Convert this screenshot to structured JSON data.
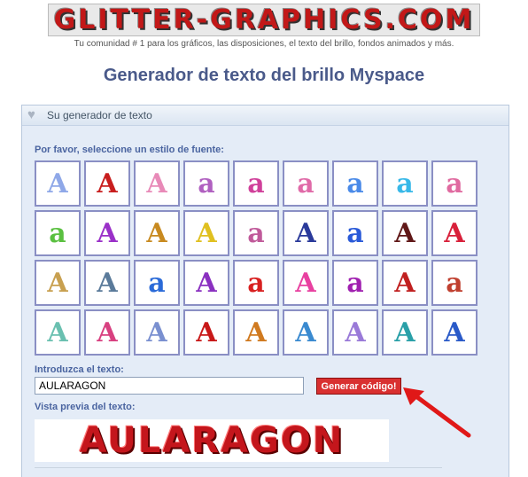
{
  "header": {
    "logo": "GLITTER-GRAPHICS.COM",
    "tagline": "Tu comunidad # 1 para los gráficos, las disposiciones, el texto del brillo, fondos animados y más."
  },
  "page_title": "Generador de texto del brillo Myspace",
  "panel": {
    "title": "Su generador de texto",
    "font_style_label": "Por favor, seleccione un estilo de fuente:",
    "input_label": "Introduzca el texto:",
    "input_value": "AULARAGON",
    "generate_button": "Generar código!",
    "preview_label": "Vista previa del texto:",
    "preview_text": "AULARAGON"
  },
  "font_styles": [
    {
      "glyph": "A",
      "color": "#8fa8e8"
    },
    {
      "glyph": "A",
      "color": "#c81e1e"
    },
    {
      "glyph": "A",
      "color": "#e88ab8"
    },
    {
      "glyph": "a",
      "color": "#b060c0"
    },
    {
      "glyph": "a",
      "color": "#d0409a"
    },
    {
      "glyph": "a",
      "color": "#e06aa8"
    },
    {
      "glyph": "a",
      "color": "#4a8ae8"
    },
    {
      "glyph": "a",
      "color": "#38b8e8"
    },
    {
      "glyph": "a",
      "color": "#e06aa0"
    },
    {
      "glyph": "a",
      "color": "#5ac040"
    },
    {
      "glyph": "A",
      "color": "#9a30c8"
    },
    {
      "glyph": "A",
      "color": "#c88a20"
    },
    {
      "glyph": "A",
      "color": "#e0c020"
    },
    {
      "glyph": "a",
      "color": "#c05a9a"
    },
    {
      "glyph": "A",
      "color": "#2a3a9a"
    },
    {
      "glyph": "a",
      "color": "#2a5ad8"
    },
    {
      "glyph": "A",
      "color": "#601818"
    },
    {
      "glyph": "A",
      "color": "#d8203a"
    },
    {
      "glyph": "A",
      "color": "#c8a050"
    },
    {
      "glyph": "A",
      "color": "#5a7a9a"
    },
    {
      "glyph": "a",
      "color": "#2a6ad8"
    },
    {
      "glyph": "A",
      "color": "#8a30c0"
    },
    {
      "glyph": "a",
      "color": "#d82020"
    },
    {
      "glyph": "A",
      "color": "#e840a0"
    },
    {
      "glyph": "a",
      "color": "#a020b0"
    },
    {
      "glyph": "A",
      "color": "#c02020"
    },
    {
      "glyph": "a",
      "color": "#c04030"
    },
    {
      "glyph": "A",
      "color": "#6ac0b0"
    },
    {
      "glyph": "A",
      "color": "#d84080"
    },
    {
      "glyph": "A",
      "color": "#7a90d0"
    },
    {
      "glyph": "A",
      "color": "#c81818"
    },
    {
      "glyph": "A",
      "color": "#d07a20"
    },
    {
      "glyph": "A",
      "color": "#3a8ad0"
    },
    {
      "glyph": "A",
      "color": "#9a7ad8"
    },
    {
      "glyph": "A",
      "color": "#2aa0a8"
    },
    {
      "glyph": "A",
      "color": "#2a5ac8"
    }
  ]
}
